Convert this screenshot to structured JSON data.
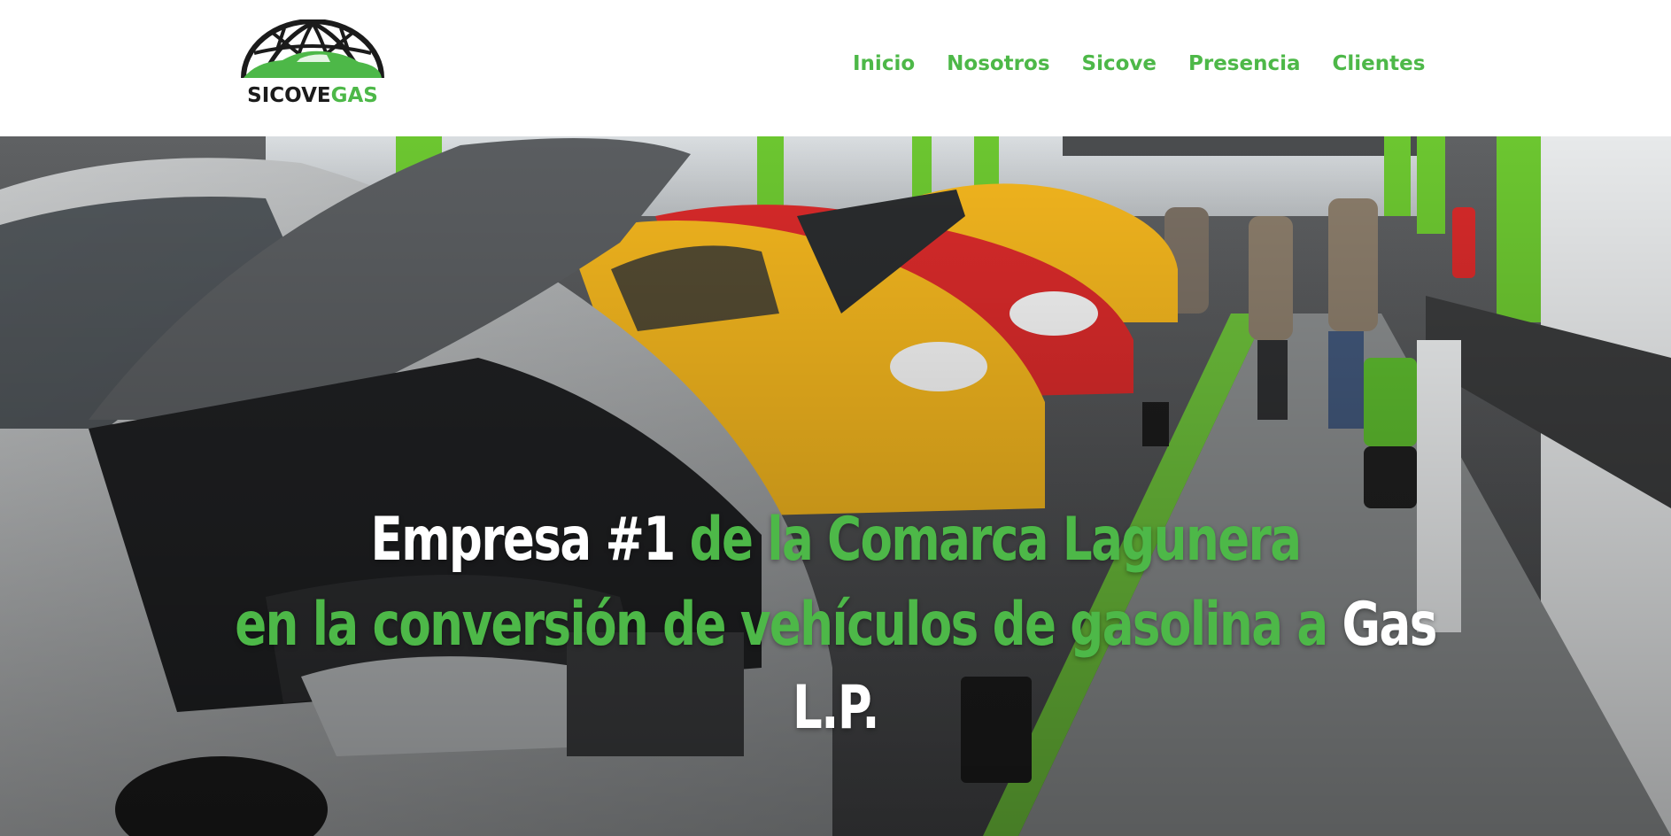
{
  "brand": {
    "name_part1": "SICOVE",
    "name_part2": "GAS",
    "logo_icon": "globe-with-car-icon",
    "colors": {
      "green": "#4db848",
      "dark": "#1b1b1b"
    }
  },
  "nav": {
    "items": [
      {
        "label": "Inicio"
      },
      {
        "label": "Nosotros"
      },
      {
        "label": "Sicove"
      },
      {
        "label": "Presencia"
      },
      {
        "label": "Clientes"
      }
    ]
  },
  "hero": {
    "line1_white": "Empresa #1",
    "line1_green": "de la Comarca Lagunera",
    "line2_green": "en la conversión de vehículos de gasolina a",
    "line2_white": "Gas",
    "line3_white": "L.P."
  }
}
